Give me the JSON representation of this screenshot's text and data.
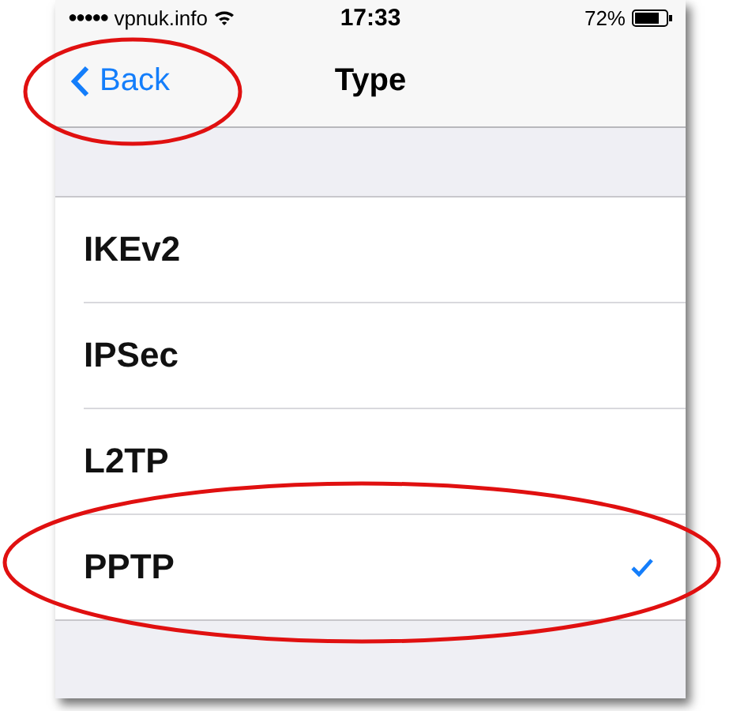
{
  "status_bar": {
    "signal_dots": "●●●●●",
    "carrier": "vpnuk.info",
    "time": "17:33",
    "battery": "72%"
  },
  "nav_bar": {
    "back": "Back",
    "title": "Type"
  },
  "options": [
    {
      "label": "IKEv2",
      "selected": false
    },
    {
      "label": "IPSec",
      "selected": false
    },
    {
      "label": "L2TP",
      "selected": false
    },
    {
      "label": "PPTP",
      "selected": true
    }
  ]
}
